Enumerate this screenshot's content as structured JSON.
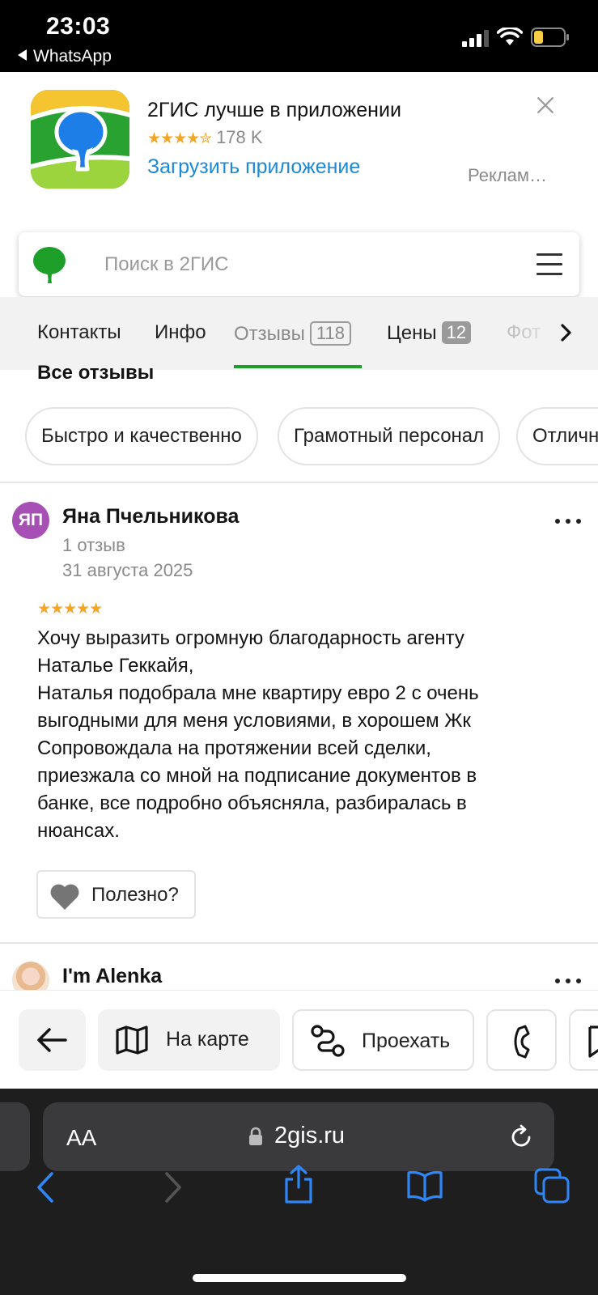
{
  "status_bar": {
    "time": "23:03",
    "back_app": "WhatsApp",
    "icons": [
      "signal-icon",
      "wifi-icon",
      "battery-icon"
    ],
    "battery_level": 0.3,
    "battery_color": "#f7ce46"
  },
  "app_banner": {
    "title": "2ГИС лучше в приложении",
    "stars": "★★★★✮",
    "rating_count": "178 K",
    "link": "Загрузить приложение",
    "ad_label": "Реклам…",
    "close_icon": "close-icon"
  },
  "search": {
    "placeholder": "Поиск в 2ГИС",
    "logo_color": "#1e9f29"
  },
  "tabs": [
    {
      "label": "Контакты"
    },
    {
      "label": "Инфо"
    },
    {
      "label": "Отзывы",
      "badge": "118"
    },
    {
      "label": "Цены",
      "badge": "12"
    },
    {
      "label": "Фот"
    }
  ],
  "reviews_section": {
    "title": "Все отзывы",
    "chips": [
      "Быстро и качественно",
      "Грамотный персонал",
      "Отличн"
    ]
  },
  "reviews": [
    {
      "initials": "ЯП",
      "avatar_color": "#a64fb4",
      "name": "Яна Пчельникова",
      "review_count": "1 отзыв",
      "date": "31 августа 2025",
      "rating": 5,
      "stars": "★★★★★",
      "text_lines": [
        "Хочу выразить огромную благодарность агенту",
        "Наталье Геккайя,",
        "Наталья подобрала мне квартиру евро 2 с очень",
        "выгодными для меня условиями, в хорошем Жк",
        "Сопровождала на протяжении всей сделки,",
        "приезжала со мной на подписание документов в",
        "банке, все подробно объясняла, разбиралась в",
        "нюансах."
      ],
      "helpful_label": "Полезно?"
    },
    {
      "name": "I'm Alenka"
    }
  ],
  "action_bar": {
    "back_icon": "arrow-left-icon",
    "map_label": "На карте",
    "route_label": "Проехать",
    "phone_icon": "phone-icon",
    "bookmark_icon": "bookmark-icon"
  },
  "browser": {
    "aa_label": "AA",
    "url": "2gis.ru",
    "nav_icons": [
      "back-icon",
      "forward-icon",
      "share-icon",
      "bookmarks-icon",
      "tabs-icon"
    ],
    "accent": "#2f86f6"
  }
}
